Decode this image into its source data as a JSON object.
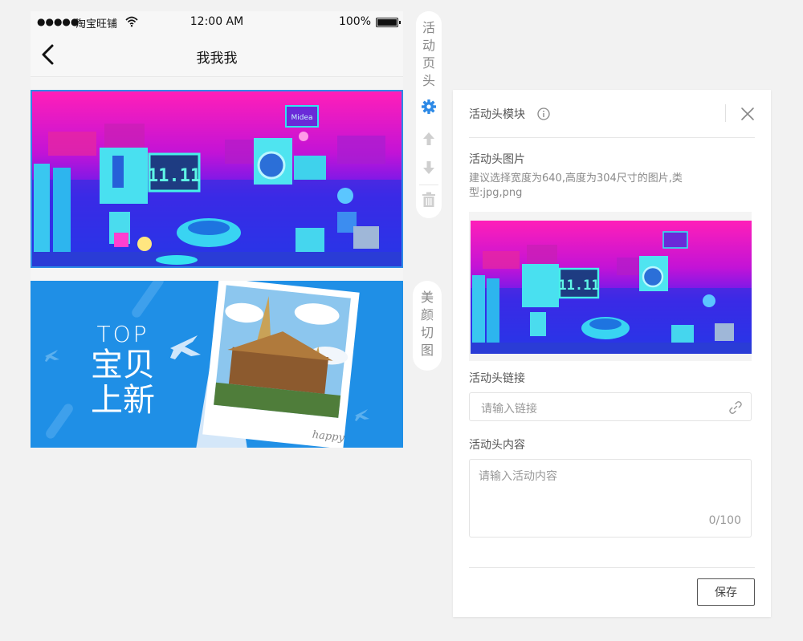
{
  "statusbar": {
    "signal": "●●●●●",
    "carrier": "淘宝旺铺",
    "time": "12:00 AM",
    "battery": "100%"
  },
  "navbar": {
    "title": "我我我"
  },
  "banners": {
    "first": {
      "badge": "11.11",
      "logo": "Midea"
    },
    "second": {
      "top": "TOP",
      "line1": "宝贝",
      "line2": "上新",
      "caption": "happy"
    }
  },
  "toolbar1": {
    "label": [
      "活",
      "动",
      "页",
      "头"
    ],
    "icons": [
      "gear-icon",
      "arrow-up-icon",
      "arrow-down-icon",
      "trash-icon"
    ]
  },
  "toolbar2": {
    "label": [
      "美",
      "颜",
      "切",
      "图"
    ]
  },
  "panel": {
    "title": "活动头模块",
    "image_label": "活动头图片",
    "image_hint": "建议选择宽度为640,高度为304尺寸的图片,类型:jpg,png",
    "preview_badge": "11.11",
    "link_label": "活动头链接",
    "link_placeholder": "请输入链接",
    "content_label": "活动头内容",
    "content_placeholder": "请输入活动内容",
    "counter": "0/100",
    "save_label": "保存"
  },
  "colors": {
    "accent": "#2e8ae6",
    "banner_blue": "#1f8fe6",
    "banner_magenta": "#e0189e"
  }
}
